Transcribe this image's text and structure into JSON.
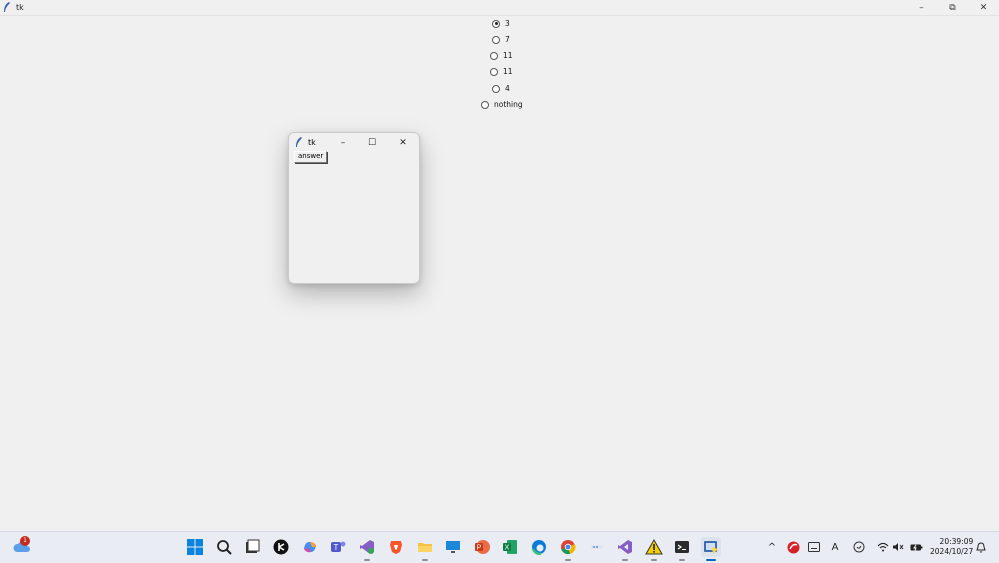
{
  "window": {
    "title": "tk",
    "controls": {
      "minimize": "–",
      "maximize": "⧉",
      "close": "✕"
    }
  },
  "radios": [
    {
      "label": "3",
      "checked": true
    },
    {
      "label": "7",
      "checked": false
    },
    {
      "label": "11",
      "checked": false
    },
    {
      "label": "11",
      "checked": false
    },
    {
      "label": "4",
      "checked": false
    },
    {
      "label": "nothing",
      "checked": false
    }
  ],
  "popup": {
    "title": "tk",
    "controls": {
      "minimize": "–",
      "maximize": "☐",
      "close": "✕"
    },
    "button_label": "answer"
  },
  "taskbar": {
    "notification_count": "1",
    "apps": [
      "windows-start-icon",
      "search-icon",
      "file-explorer-icon",
      "media-app-icon",
      "copilot-icon",
      "teams-icon",
      "visual-studio-icon",
      "brave-browser-icon",
      "folder-icon",
      "remote-desktop-icon",
      "powerpoint-icon",
      "excel-icon",
      "edge-icon",
      "chrome-icon",
      "app-icon",
      "visual-studio-purple-icon",
      "warning-app-icon",
      "terminal-icon",
      "python-tk-icon"
    ],
    "tray": {
      "chevron": "^",
      "ime": "A",
      "time": "20:39:09",
      "date": "2024/10/27"
    }
  },
  "colors": {
    "accent": "#0067c0",
    "background": "#f0f0f0",
    "badge": "#c42b1c"
  }
}
